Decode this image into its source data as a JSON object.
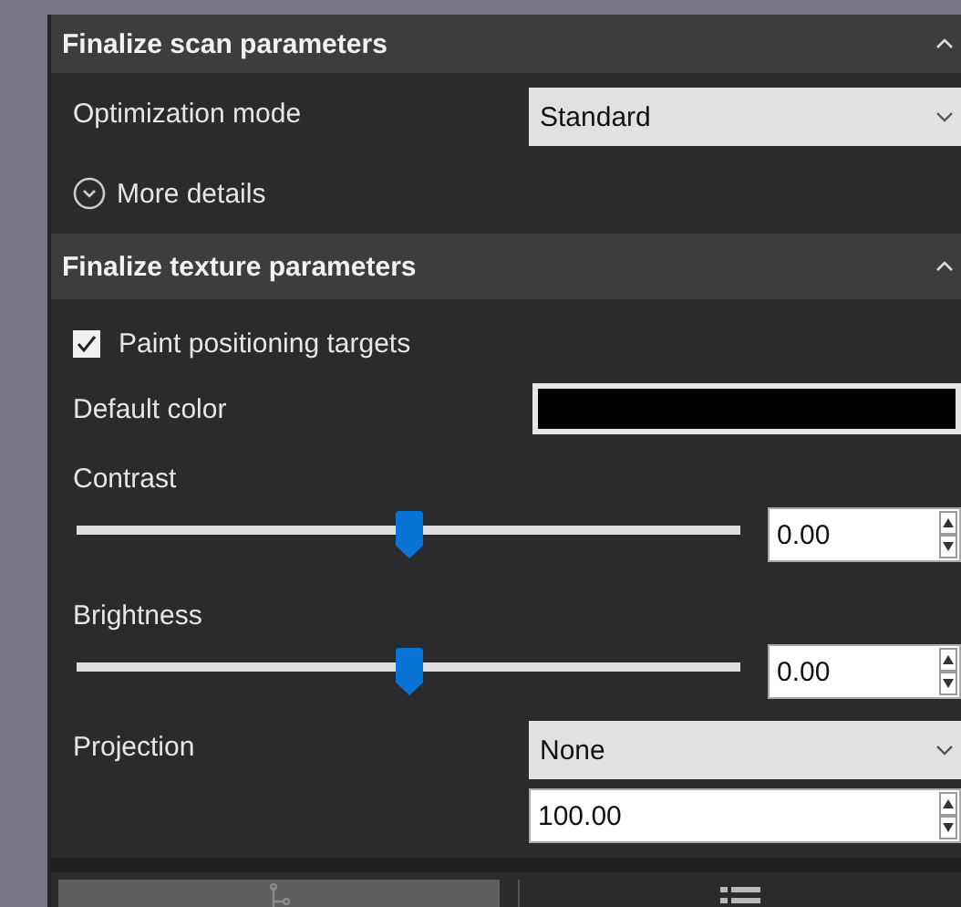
{
  "sections": [
    {
      "title": "Finalize scan parameters",
      "expanded": true,
      "rows": [
        {
          "kind": "dropdown",
          "label": "Optimization mode",
          "value": "Standard"
        },
        {
          "kind": "expander",
          "label": "More details",
          "expanded": false
        }
      ]
    },
    {
      "title": "Finalize texture parameters",
      "expanded": true,
      "rows": [
        {
          "kind": "checkbox",
          "label": "Paint positioning targets",
          "checked": true
        },
        {
          "kind": "color",
          "label": "Default color",
          "color": "#000000"
        },
        {
          "kind": "slider",
          "label": "Contrast",
          "level": 0.5,
          "value": "0.00"
        },
        {
          "kind": "slider",
          "label": "Brightness",
          "level": 0.5,
          "value": "0.00"
        },
        {
          "kind": "dropdown",
          "label": "Projection",
          "value": "None",
          "extra_value": "100.00"
        }
      ]
    }
  ],
  "bottom_tabs": [
    {
      "kind": "tree",
      "selected": true
    },
    {
      "kind": "list",
      "selected": false
    }
  ]
}
